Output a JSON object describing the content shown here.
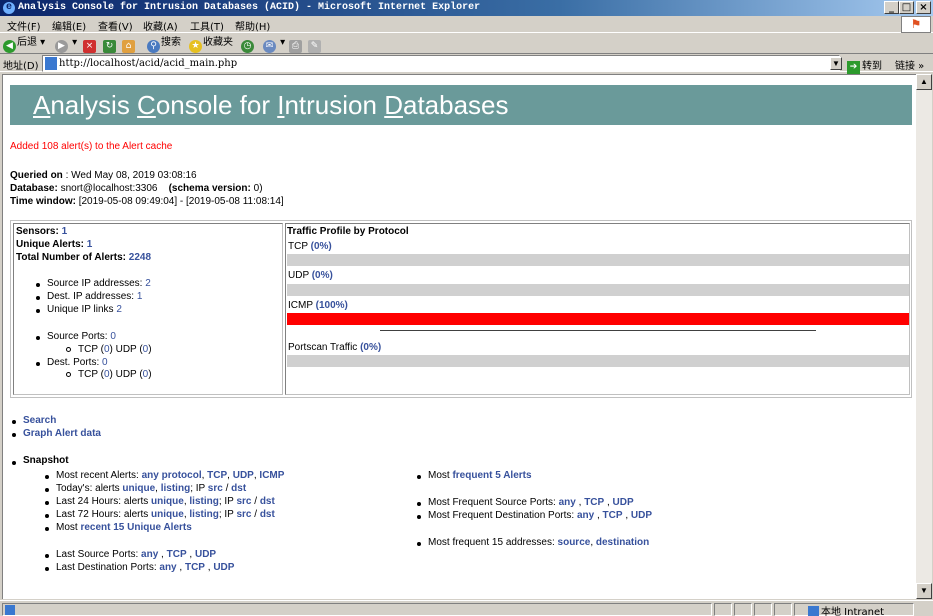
{
  "window": {
    "title": "Analysis Console for Intrusion Databases (ACID) - Microsoft Internet Explorer",
    "controls": {
      "minimize": "_",
      "maximize": "□",
      "close": "×"
    }
  },
  "menu": [
    "文件(F)",
    "编辑(E)",
    "查看(V)",
    "收藏(A)",
    "工具(T)",
    "帮助(H)"
  ],
  "toolbar": {
    "back": "后退",
    "search": "搜索",
    "favorites": "收藏夹"
  },
  "address": {
    "label": "地址(D)",
    "url": "http://localhost/acid/acid_main.php",
    "go": "转到",
    "links": "链接 »"
  },
  "status": {
    "zone": "本地 Intranet"
  },
  "page": {
    "banner": {
      "a": "A",
      "a_rest": "nalysis ",
      "c": "C",
      "c_rest": "onsole for ",
      "i": "I",
      "i_rest": "ntrusion ",
      "d": "D",
      "d_rest": "atabases"
    },
    "cache_message": "Added 108 alert(s) to the Alert cache",
    "query": {
      "queried_label": "Queried on",
      "queried_value": " : Wed May 08, 2019 03:08:16",
      "database_label": "Database:",
      "database_value": " snort@localhost:3306",
      "schema_label": "(schema version:",
      "schema_value": " 0)",
      "window_label": "Time window:",
      "window_value": " [2019-05-08 09:49:04] - [2019-05-08 11:08:14]"
    },
    "summary": {
      "sensors_label": "Sensors:",
      "sensors": "1",
      "unique_label": "Unique Alerts:",
      "unique": "1",
      "total_label": "Total Number of Alerts:",
      "total": "2248",
      "src_ip_label": "Source IP addresses:",
      "src_ip": "2",
      "dst_ip_label": "Dest. IP addresses:",
      "dst_ip": "1",
      "links_label": "Unique IP links",
      "links": "2",
      "src_ports_label": "Source Ports:",
      "src_ports": "0",
      "dst_ports_label": "Dest. Ports:",
      "dst_ports": "0",
      "tcp_label": "TCP (",
      "udp_label": ") UDP (",
      "close": ")",
      "src_tcp": "0",
      "src_udp": "0",
      "dst_tcp": "0",
      "dst_udp": "0"
    },
    "traffic": {
      "title": "Traffic Profile by Protocol",
      "protocols": [
        {
          "name": "TCP",
          "pct": "(0%)",
          "fraction": 0.0
        },
        {
          "name": "UDP",
          "pct": "(0%)",
          "fraction": 0.0
        },
        {
          "name": "ICMP",
          "pct": "(100%)",
          "fraction": 1.0
        }
      ],
      "portscan": {
        "name": "Portscan Traffic",
        "pct": "(0%)",
        "fraction": 0.0
      },
      "fill_color": "#ff0000"
    },
    "nav": {
      "search": "Search",
      "graph": "Graph Alert data",
      "snapshot": "Snapshot"
    },
    "snapshot": {
      "recent_label": "Most recent Alerts:",
      "any_protocol": "any protocol",
      "tcp": "TCP",
      "udp": "UDP",
      "icmp": "ICMP",
      "today_label": "Today's: alerts",
      "h24_label": "Last 24 Hours: alerts",
      "h72_label": "Last 72 Hours: alerts",
      "unique": "unique",
      "listing": "listing",
      "ip_label": "; IP",
      "src": "src",
      "dst": "dst",
      "slash": "/",
      "recent15_label": "Most",
      "recent15": "recent 15 Unique Alerts",
      "last_src_label": "Last Source Ports:",
      "last_dst_label": "Last Destination Ports:",
      "any": "any",
      "freq5_label": "Most",
      "freq5": "frequent 5 Alerts",
      "freq_src_label": "Most Frequent Source Ports:",
      "freq_dst_label": "Most Frequent Destination Ports:",
      "freq15_label": "Most frequent 15 addresses:",
      "source": "source",
      "destination": "destination"
    },
    "link_color": "#37519c"
  }
}
